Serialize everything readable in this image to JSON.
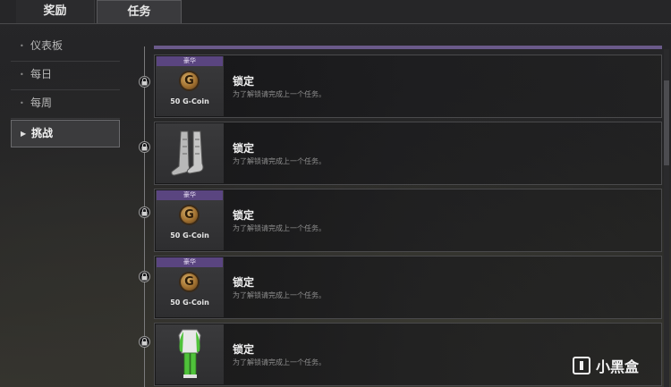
{
  "tabs": {
    "reward": "奖励",
    "task": "任务"
  },
  "nav": {
    "items": [
      {
        "label": "仪表板",
        "active": false
      },
      {
        "label": "每日",
        "active": false
      },
      {
        "label": "每周",
        "active": false
      },
      {
        "label": "挑战",
        "active": true
      }
    ]
  },
  "missions": [
    {
      "badge": "豪华",
      "reward_type": "coin",
      "coin_glyph": "G",
      "reward_label": "50 G-Coin",
      "title": "锁定",
      "desc": "为了解锁请完成上一个任务。"
    },
    {
      "badge": "",
      "reward_type": "boots",
      "reward_label": "",
      "title": "锁定",
      "desc": "为了解锁请完成上一个任务。"
    },
    {
      "badge": "豪华",
      "reward_type": "coin",
      "coin_glyph": "G",
      "reward_label": "50 G-Coin",
      "title": "锁定",
      "desc": "为了解锁请完成上一个任务。"
    },
    {
      "badge": "豪华",
      "reward_type": "coin",
      "coin_glyph": "G",
      "reward_label": "50 G-Coin",
      "title": "锁定",
      "desc": "为了解锁请完成上一个任务。"
    },
    {
      "badge": "",
      "reward_type": "outfit",
      "reward_label": "",
      "title": "锁定",
      "desc": "为了解锁请完成上一个任务。"
    }
  ],
  "watermark": {
    "text": "小黑盒"
  },
  "colors": {
    "badge": "#5a4580",
    "accent_bar": "#6a5a8a",
    "outfit_green": "#4fc23a"
  }
}
